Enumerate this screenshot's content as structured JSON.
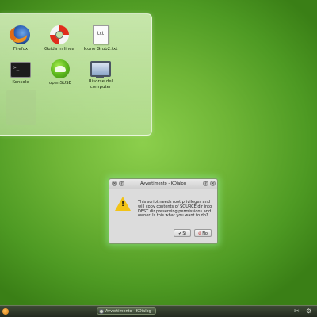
{
  "desktop": {
    "icons": [
      {
        "label": "Firefox",
        "icon": "firefox-icon"
      },
      {
        "label": "Guida in linea",
        "icon": "help-icon"
      },
      {
        "label": "Icone Grub2.txt",
        "icon": "text-file-icon",
        "glyph": "txt"
      },
      {
        "label": "Konsole",
        "icon": "konsole-icon"
      },
      {
        "label": "openSUSE",
        "icon": "opensuse-icon"
      },
      {
        "label": "Risorse del computer",
        "icon": "computer-icon"
      }
    ]
  },
  "dialog": {
    "title": "Avvertimento - KDialog",
    "message": "This script needs root privileges and will copy contents of SOURCE dir into DEST dir preserving permissions and owner. Is this what you want to do?",
    "yes_label": "Sì",
    "no_label": "No",
    "warning_glyph": "!"
  },
  "taskbar": {
    "task_label": "Avvertimento - KDialog"
  },
  "colors": {
    "desktop_green": "#6fb536",
    "warning_yellow": "#f2c316",
    "dialog_glow": "#8ce68c"
  }
}
